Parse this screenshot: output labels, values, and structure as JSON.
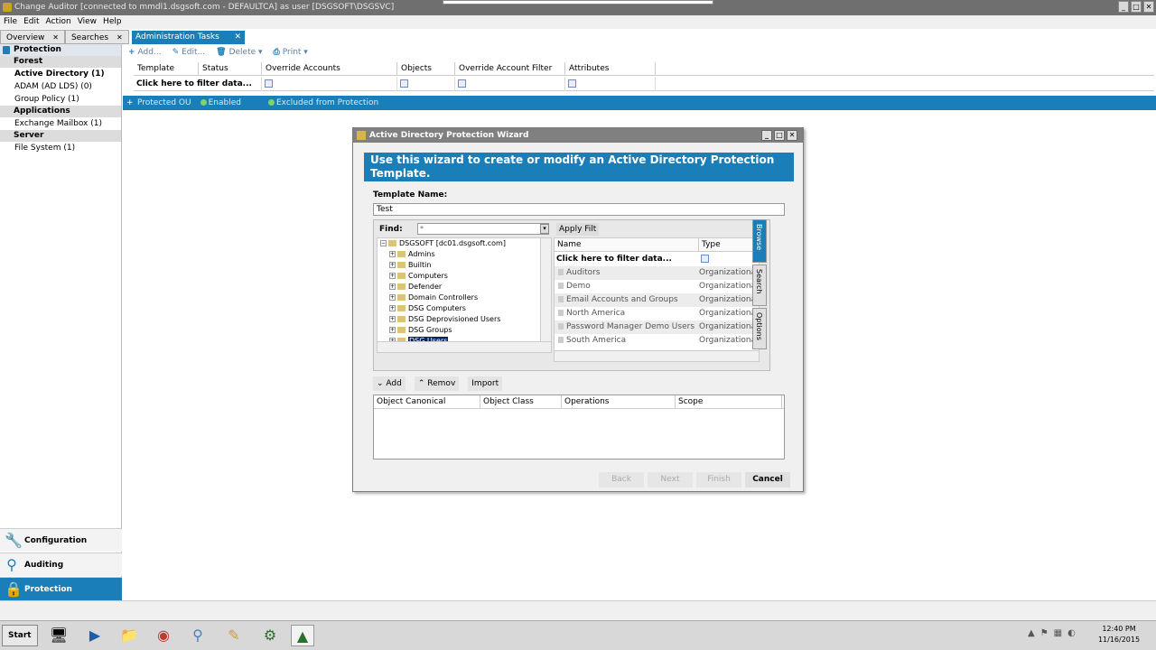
{
  "titlebar": {
    "title": "Change Auditor [connected to mmdl1.dsgsoft.com - DEFAULTCA] as user [DSGSOFT\\DSGSVC]"
  },
  "menu": [
    "File",
    "Edit",
    "Action",
    "View",
    "Help"
  ],
  "tabs": [
    {
      "label": "Overview",
      "close": "✕"
    },
    {
      "label": "Searches",
      "close": "✕"
    }
  ],
  "active_tab": {
    "label": "Administration Tasks",
    "close": "✕"
  },
  "sidebar": {
    "header": "Protection",
    "groups": [
      {
        "title": "Forest",
        "items": [
          {
            "label": "Active Directory (1)",
            "bold": true
          },
          {
            "label": "ADAM (AD LDS) (0)",
            "bold": false
          },
          {
            "label": "Group Policy (1)",
            "bold": false
          }
        ]
      },
      {
        "title": "Applications",
        "items": [
          {
            "label": "Exchange Mailbox (1)",
            "bold": false
          }
        ]
      },
      {
        "title": "Server",
        "items": [
          {
            "label": "File System (1)",
            "bold": false
          }
        ]
      }
    ],
    "nav": [
      {
        "label": "Configuration",
        "icon": "wrench-icon"
      },
      {
        "label": "Auditing",
        "icon": "magnifier-icon"
      },
      {
        "label": "Protection",
        "icon": "lock-icon"
      }
    ]
  },
  "toolbar": {
    "add": "Add...",
    "edit": "Edit...",
    "delete": "Delete",
    "print": "Print"
  },
  "grid": {
    "columns": [
      "Template",
      "Status",
      "Override Accounts",
      "Objects",
      "Override Account Filter",
      "Attributes"
    ],
    "filter_text": "Click here to filter data...",
    "row": {
      "template": "Protected OU",
      "status": "Enabled",
      "override": "Excluded from Protection"
    }
  },
  "wizard": {
    "title": "Active Directory Protection Wizard",
    "banner": "Use this wizard to create or modify an Active Directory Protection Template.",
    "template_name_label": "Template Name:",
    "template_name_value": "Test",
    "find_label": "Find:",
    "find_value": "*",
    "apply_filter": "Apply Filt",
    "tree": [
      {
        "label": "DSGSOFT [dc01.dsgsoft.com]",
        "root": true
      },
      {
        "label": "Admins"
      },
      {
        "label": "Builtin"
      },
      {
        "label": "Computers"
      },
      {
        "label": "Defender"
      },
      {
        "label": "Domain Controllers"
      },
      {
        "label": "DSG Computers"
      },
      {
        "label": "DSG Deprovisioned Users"
      },
      {
        "label": "DSG Groups"
      },
      {
        "label": "DSG Users",
        "selected": true
      }
    ],
    "list_columns": [
      "Name",
      "Type"
    ],
    "list_filter": "Click here to filter data...",
    "list_rows": [
      {
        "name": "Auditors",
        "type": "Organizational"
      },
      {
        "name": "Demo",
        "type": "Organizational"
      },
      {
        "name": "Email Accounts and Groups",
        "type": "Organizational"
      },
      {
        "name": "North America",
        "type": "Organizational"
      },
      {
        "name": "Password Manager Demo Users",
        "type": "Organizational"
      },
      {
        "name": "South America",
        "type": "Organizational"
      }
    ],
    "vtabs": [
      "Browse",
      "Search",
      "Options"
    ],
    "actions": {
      "add": "Add",
      "remove": "Remov",
      "import": "Import"
    },
    "obj_columns": [
      "Object Canonical",
      "Object Class",
      "Operations",
      "Scope"
    ],
    "buttons": {
      "back": "Back",
      "next": "Next",
      "finish": "Finish",
      "cancel": "Cancel"
    }
  },
  "taskbar": {
    "start": "Start",
    "time": "12:40 PM",
    "date": "11/16/2015"
  }
}
